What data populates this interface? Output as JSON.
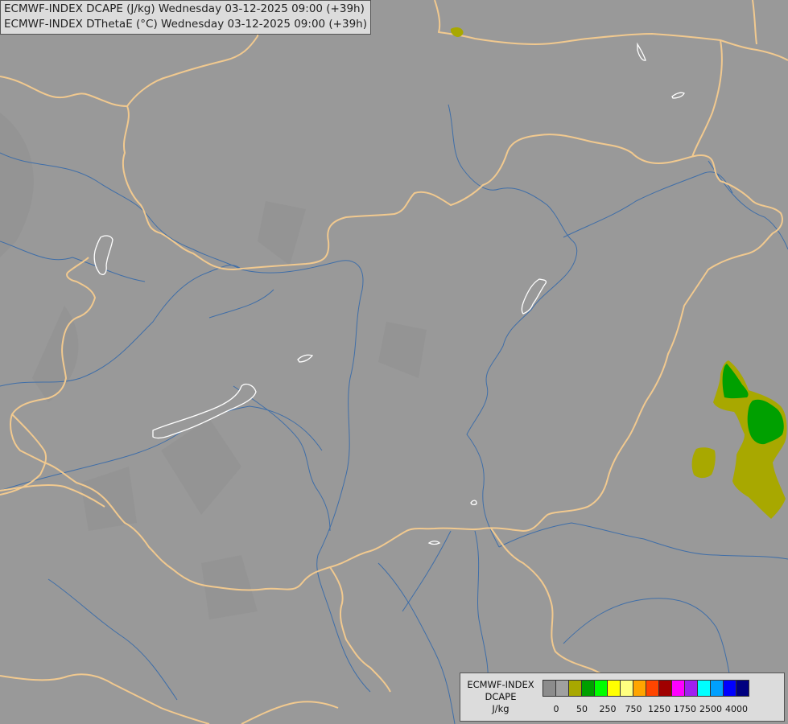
{
  "title": {
    "line1": "ECMWF-INDEX DCAPE (J/kg) Wednesday 03-12-2025 09:00 (+39h)",
    "line2": "ECMWF-INDEX DThetaE (°C) Wednesday 03-12-2025 09:00 (+39h)"
  },
  "colors": {
    "background": "#999999",
    "borders": "#f1c98f",
    "rivers": "#3f6ea8",
    "lakes": "#ffffff",
    "dcape_50": "#a8a800",
    "dcape_250": "#00a000"
  },
  "legend": {
    "title_line1": "ECMWF-INDEX",
    "title_line2": "DCAPE",
    "title_line3": "J/kg",
    "swatches": [
      "#8c8c8c",
      "#a0a0a0",
      "#a8a800",
      "#00a000",
      "#00ff00",
      "#ffff00",
      "#ffff80",
      "#ffa500",
      "#ff4500",
      "#a00000",
      "#ff00ff",
      "#a020f0",
      "#00ffff",
      "#00a0ff",
      "#0000ff",
      "#000080"
    ],
    "ticks": [
      {
        "label": "0",
        "index": 1
      },
      {
        "label": "50",
        "index": 3
      },
      {
        "label": "250",
        "index": 5
      },
      {
        "label": "750",
        "index": 7
      },
      {
        "label": "1250",
        "index": 9
      },
      {
        "label": "1750",
        "index": 11
      },
      {
        "label": "2500",
        "index": 13
      },
      {
        "label": "4000",
        "index": 15
      }
    ]
  }
}
